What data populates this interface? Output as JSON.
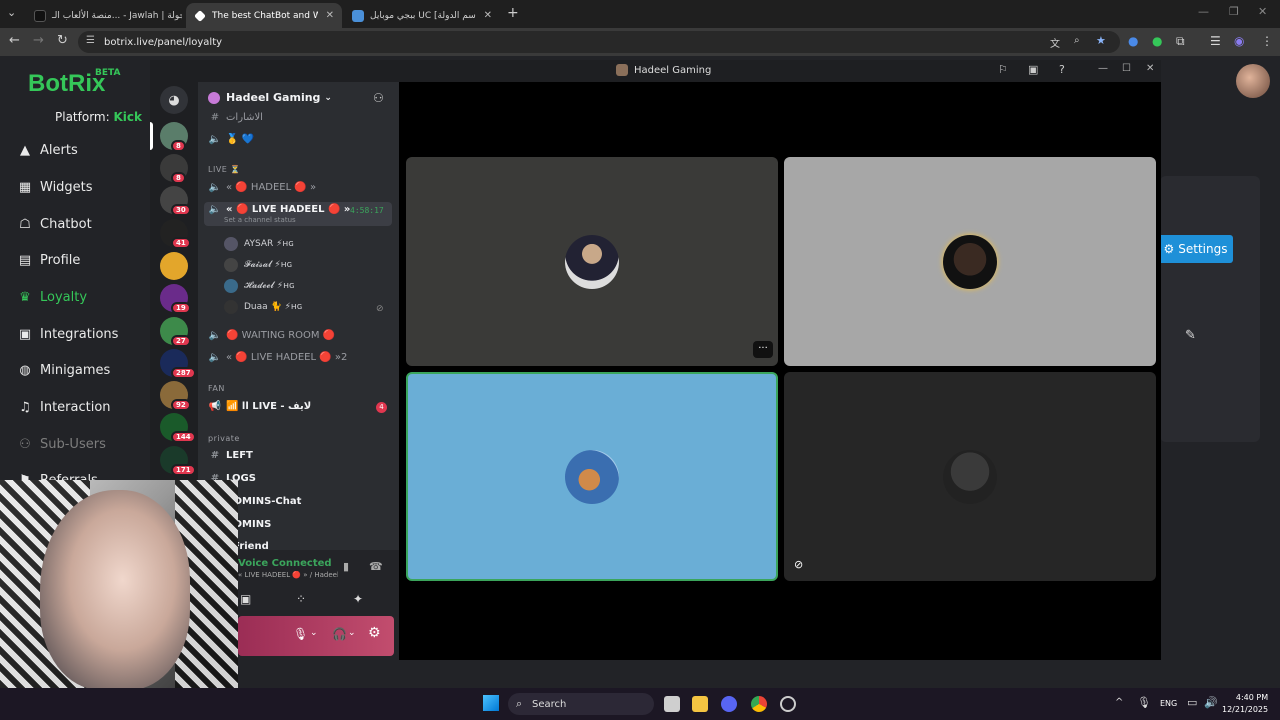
{
  "browser": {
    "tabs": [
      {
        "title": "منصة الألعاب الـ... - Jawlah | جولة"
      },
      {
        "title": "The best ChatBot and Widgets"
      },
      {
        "title": "ببجي موبايل UC [اسم الدولة] | جـ..."
      }
    ],
    "url": "botrix.live/panel/loyalty"
  },
  "botrix": {
    "logo": "BotRix",
    "beta": "BETA",
    "platform_label": "Platform:",
    "platform_value": "Kick",
    "nav": [
      {
        "label": "Alerts",
        "icon": "warning-icon"
      },
      {
        "label": "Widgets",
        "icon": "grid-icon"
      },
      {
        "label": "Chatbot",
        "icon": "robot-icon"
      },
      {
        "label": "Profile",
        "icon": "id-card-icon"
      },
      {
        "label": "Loyalty",
        "icon": "trophy-icon"
      },
      {
        "label": "Integrations",
        "icon": "plugin-icon"
      },
      {
        "label": "Minigames",
        "icon": "gamepad-icon"
      },
      {
        "label": "Interaction",
        "icon": "music-icon"
      },
      {
        "label": "Sub-Users",
        "icon": "users-icon"
      },
      {
        "label": "Referrals",
        "icon": "share-icon"
      }
    ],
    "settings_button": "Settings"
  },
  "discord": {
    "window_title": "Hadeel Gaming",
    "server_name": "Hadeel Gaming",
    "servers": [
      {
        "badge": "8",
        "color": "#5a7d6a"
      },
      {
        "badge": "8",
        "color": "#3a3a3a"
      },
      {
        "badge": "30",
        "color": "#444"
      },
      {
        "badge": "41",
        "color": "#222"
      },
      {
        "badge": "",
        "color": "#e3a62b"
      },
      {
        "badge": "19",
        "color": "#6a2b8a"
      },
      {
        "badge": "27",
        "color": "#3d8a4a"
      },
      {
        "badge": "287",
        "color": "#1a2a5a"
      },
      {
        "badge": "92",
        "color": "#8a6a3a"
      },
      {
        "badge": "144",
        "color": "#1a5a2a"
      },
      {
        "badge": "171",
        "color": "#1a3a2a"
      }
    ],
    "top_channel": "الاشارات",
    "categories": {
      "live": "LIVE ⏳",
      "fan": "FAN",
      "private": "private"
    },
    "channels": {
      "hadeel": "« 🔴 HADEEL 🔴 »",
      "live_hadeel": "« 🔴 LIVE HADEEL 🔴 »",
      "live_timer": "4:58:17",
      "channel_status": "Set a channel status",
      "waiting_room": "🔴 WAITING ROOM 🔴",
      "live_hadeel_2": "« 🔴 LIVE HADEEL 🔴 »2",
      "fan_live": "📶 ll LIVE - لايف",
      "fan_badge": "4",
      "left": "LEFT",
      "logs": "LOGS",
      "admins_chat": "ADMINS-Chat",
      "admins": "ADMINS",
      "friend": "| Friend"
    },
    "members": [
      {
        "name": "AYSAR ⚡ʜɢ"
      },
      {
        "name": "𝓕𝓪𝓲𝓼𝓪𝓵 ⚡ʜɢ"
      },
      {
        "name": "𝓗𝓪𝓭𝓮𝓮𝓵 ⚡ʜɢ"
      },
      {
        "name": "Duaa 🐈 ⚡ʜɢ"
      }
    ],
    "voice_status": "Voice Connected",
    "voice_channel": "« LIVE HADEEL 🔴 » / Hadeel Gaming"
  },
  "taskbar": {
    "search": "Search",
    "language": "ENG",
    "time": "4:40 PM",
    "date": "12/21/2025"
  }
}
